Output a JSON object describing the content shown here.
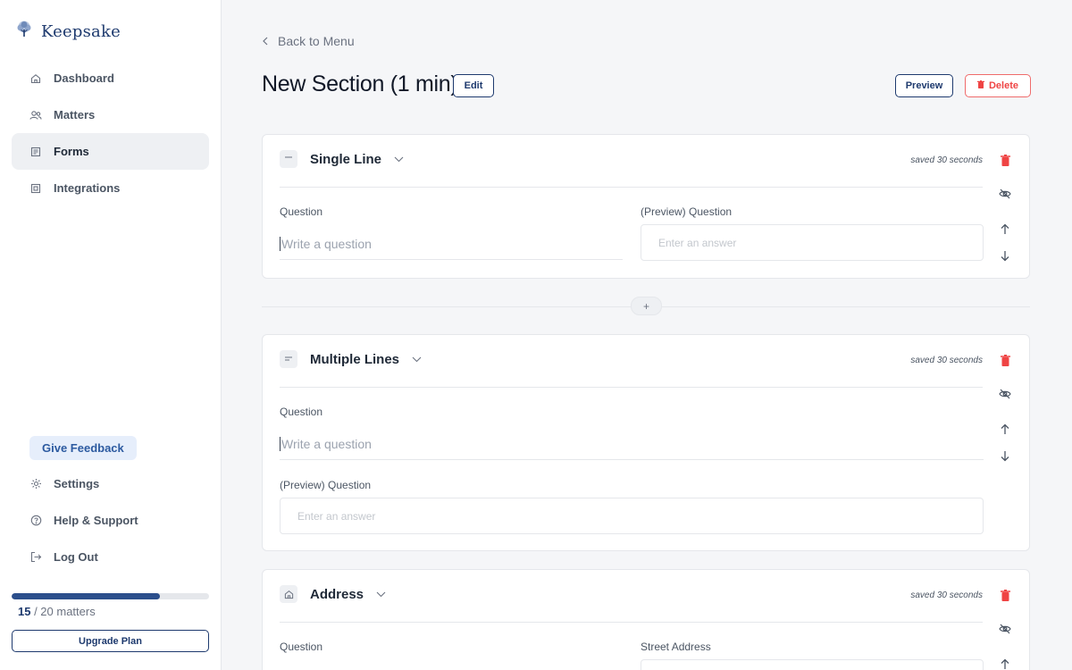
{
  "app": {
    "name": "Keepsake"
  },
  "sidebar": {
    "items": [
      {
        "label": "Dashboard",
        "icon": "home-icon"
      },
      {
        "label": "Matters",
        "icon": "users-icon"
      },
      {
        "label": "Forms",
        "icon": "form-icon",
        "active": true
      },
      {
        "label": "Integrations",
        "icon": "integrations-icon"
      }
    ],
    "feedback_label": "Give Feedback",
    "bottom_items": [
      {
        "label": "Settings",
        "icon": "gear-icon"
      },
      {
        "label": "Help & Support",
        "icon": "help-icon"
      },
      {
        "label": "Log Out",
        "icon": "logout-icon"
      }
    ],
    "usage": {
      "used": "15",
      "total_text": " / 20 matters",
      "fraction": 0.75
    },
    "upgrade_label": "Upgrade Plan"
  },
  "header": {
    "back_label": "Back to Menu",
    "title": "New Section (1 min)",
    "edit_label": "Edit",
    "preview_label": "Preview",
    "delete_label": "Delete"
  },
  "cards": [
    {
      "type": "Single Line",
      "saved": "saved 30 seconds",
      "question_label": "Question",
      "question_placeholder": "Write a question",
      "preview_label": "(Preview) Question",
      "answer_placeholder": "Enter an answer"
    },
    {
      "type": "Multiple Lines",
      "saved": "saved 30 seconds",
      "question_label": "Question",
      "question_placeholder": "Write a question",
      "preview_label": "(Preview) Question",
      "answer_placeholder": "Enter an answer"
    },
    {
      "type": "Address",
      "saved": "saved 30 seconds",
      "question_label": "Question",
      "street_label": "Street Address"
    }
  ],
  "add_label": "+",
  "colors": {
    "brand": "#1e3a6e",
    "danger": "#ef4444",
    "active_bg": "#eef0f3"
  }
}
